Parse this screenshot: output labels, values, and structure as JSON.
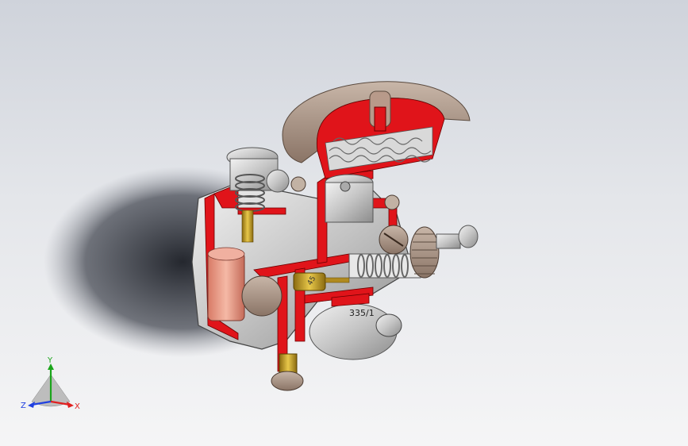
{
  "model": {
    "part_marking": "335/1",
    "jet_marking": "45"
  },
  "triad": {
    "x_label": "X",
    "y_label": "Y",
    "z_label": "Z",
    "x_color": "#e02020",
    "y_color": "#1aa51a",
    "z_color": "#2040e0"
  },
  "colors": {
    "section_red": "#e0141a",
    "metal": "#c8c8c8",
    "filter_cover": "#b09a8a",
    "brass": "#c9a227"
  }
}
